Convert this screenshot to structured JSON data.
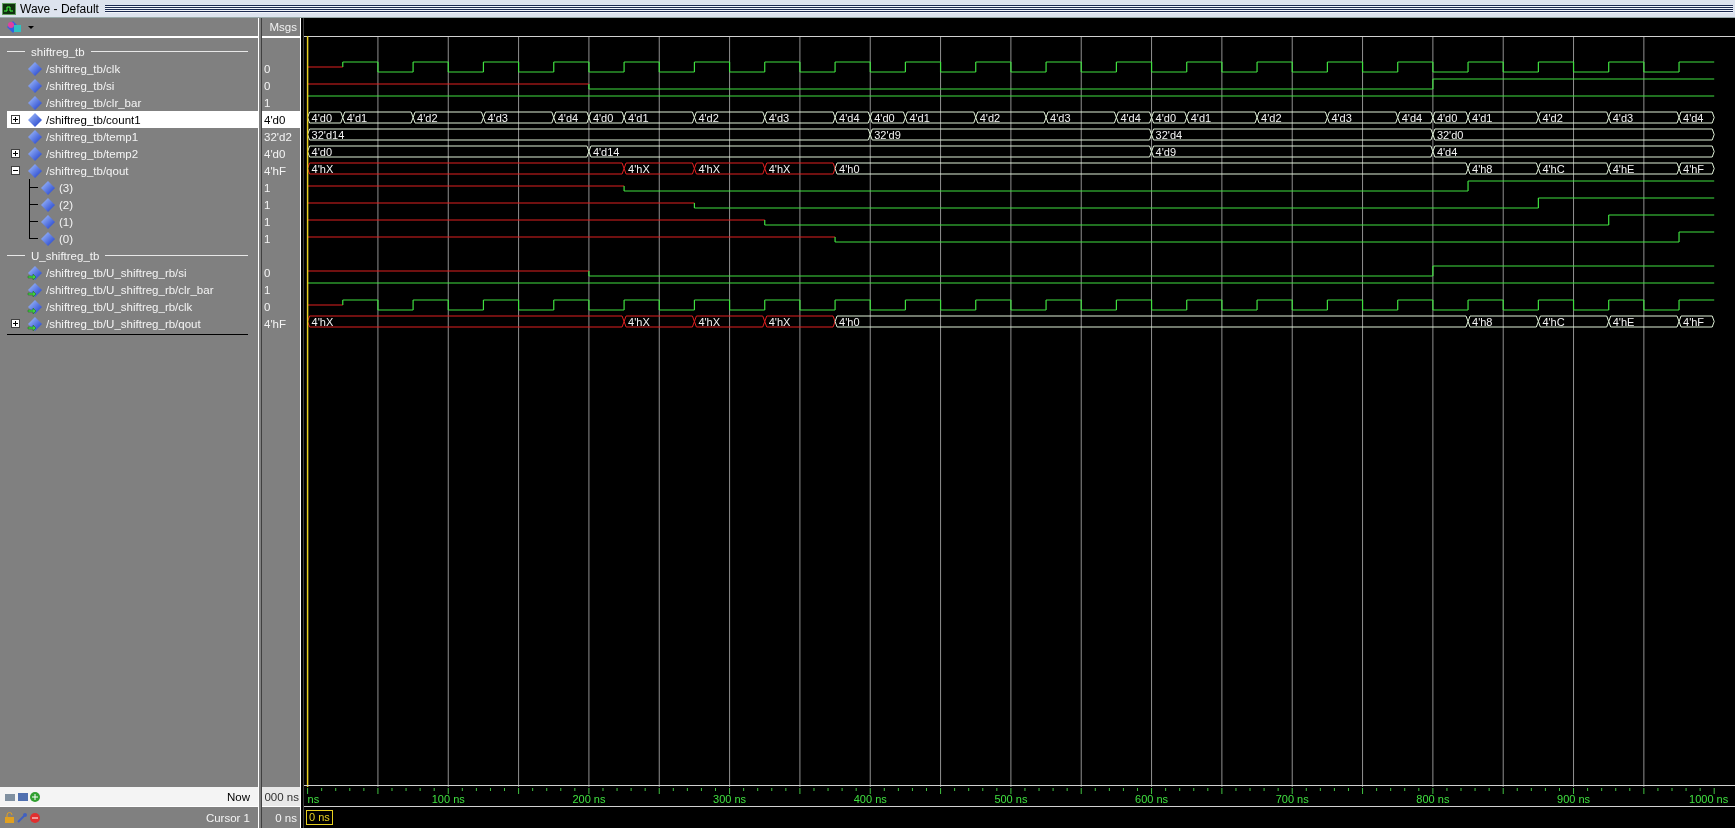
{
  "window": {
    "title": "Wave - Default"
  },
  "columns": {
    "values": "Msgs"
  },
  "signals": [
    {
      "kind": "group",
      "name": "shiftreg_tb",
      "children": [
        {
          "kind": "bit",
          "name": "/shiftreg_tb/clk",
          "value": "0",
          "port": false,
          "selected": false
        },
        {
          "kind": "bit",
          "name": "/shiftreg_tb/si",
          "value": "0",
          "port": false,
          "selected": false
        },
        {
          "kind": "bit",
          "name": "/shiftreg_tb/clr_bar",
          "value": "1",
          "port": false,
          "selected": false
        },
        {
          "kind": "bus",
          "name": "/shiftreg_tb/count1",
          "value": "4'd0",
          "port": false,
          "selected": true,
          "expanded": false,
          "segments": [
            {
              "label": "4'd0",
              "unknown": false
            },
            {
              "label": "4'd1",
              "unknown": false
            },
            {
              "label": "4'd2",
              "unknown": false
            },
            {
              "label": "4'd3",
              "unknown": false
            },
            {
              "label": "4'd4",
              "unknown": false
            },
            {
              "label": "4'd0",
              "unknown": false
            },
            {
              "label": "4'd1",
              "unknown": false
            },
            {
              "label": "4'd2",
              "unknown": false
            },
            {
              "label": "4'd3",
              "unknown": false
            },
            {
              "label": "4'd4",
              "unknown": false
            },
            {
              "label": "4'd0",
              "unknown": false
            },
            {
              "label": "4'd1",
              "unknown": false
            },
            {
              "label": "4'd2",
              "unknown": false
            },
            {
              "label": "4'd3",
              "unknown": false
            },
            {
              "label": "4'd4",
              "unknown": false
            },
            {
              "label": "4'd0",
              "unknown": false
            },
            {
              "label": "4'd1",
              "unknown": false
            },
            {
              "label": "4'd2",
              "unknown": false
            },
            {
              "label": "4'd3",
              "unknown": false
            },
            {
              "label": "4'd4",
              "unknown": false
            },
            {
              "label": "4'd0",
              "unknown": false
            },
            {
              "label": "4'd1",
              "unknown": false
            },
            {
              "label": "4'd2",
              "unknown": false
            },
            {
              "label": "4'd3",
              "unknown": false
            },
            {
              "label": "4'd4",
              "unknown": false
            }
          ]
        },
        {
          "kind": "bus",
          "name": "/shiftreg_tb/temp1",
          "value": "32'd2",
          "port": false,
          "selected": false,
          "segments": [
            {
              "label": "32'd14",
              "unknown": false
            },
            {
              "label": "32'd9",
              "unknown": false
            },
            {
              "label": "32'd4",
              "unknown": false
            },
            {
              "label": "32'd0",
              "unknown": false
            }
          ]
        },
        {
          "kind": "bus",
          "name": "/shiftreg_tb/temp2",
          "value": "4'd0",
          "port": false,
          "selected": false,
          "expanded": false,
          "segments": [
            {
              "label": "4'd0",
              "unknown": false
            },
            {
              "label": "4'd14",
              "unknown": false
            },
            {
              "label": "4'd9",
              "unknown": false
            },
            {
              "label": "4'd4",
              "unknown": false
            }
          ]
        },
        {
          "kind": "bus",
          "name": "/shiftreg_tb/qout",
          "value": "4'hF",
          "port": false,
          "selected": false,
          "expanded": true,
          "segments": [
            {
              "label": "4'hX",
              "unknown": true
            },
            {
              "label": "4'hX",
              "unknown": true
            },
            {
              "label": "4'hX",
              "unknown": true
            },
            {
              "label": "4'hX",
              "unknown": true
            },
            {
              "label": "4'h0",
              "unknown": false
            },
            {
              "label": "4'h8",
              "unknown": false
            },
            {
              "label": "4'hC",
              "unknown": false
            },
            {
              "label": "4'hE",
              "unknown": false
            },
            {
              "label": "4'hF",
              "unknown": false
            }
          ],
          "children": [
            {
              "kind": "bit",
              "name": "(3)",
              "value": "1",
              "port": false,
              "selected": false
            },
            {
              "kind": "bit",
              "name": "(2)",
              "value": "1",
              "port": false,
              "selected": false
            },
            {
              "kind": "bit",
              "name": "(1)",
              "value": "1",
              "port": false,
              "selected": false
            },
            {
              "kind": "bit",
              "name": "(0)",
              "value": "1",
              "port": false,
              "selected": false
            }
          ]
        }
      ]
    },
    {
      "kind": "group",
      "name": "U_shiftreg_tb",
      "children": [
        {
          "kind": "bit",
          "name": "/shiftreg_tb/U_shiftreg_rb/si",
          "value": "0",
          "port": true,
          "selected": false
        },
        {
          "kind": "bit",
          "name": "/shiftreg_tb/U_shiftreg_rb/clr_bar",
          "value": "1",
          "port": true,
          "selected": false
        },
        {
          "kind": "bit",
          "name": "/shiftreg_tb/U_shiftreg_rb/clk",
          "value": "0",
          "port": true,
          "selected": false
        },
        {
          "kind": "bus",
          "name": "/shiftreg_tb/U_shiftreg_rb/qout",
          "value": "4'hF",
          "port": true,
          "selected": false,
          "expanded": false,
          "segments": [
            {
              "label": "4'hX",
              "unknown": true
            },
            {
              "label": "4'hX",
              "unknown": true
            },
            {
              "label": "4'hX",
              "unknown": true
            },
            {
              "label": "4'hX",
              "unknown": true
            },
            {
              "label": "4'h0",
              "unknown": false
            },
            {
              "label": "4'h8",
              "unknown": false
            },
            {
              "label": "4'hC",
              "unknown": false
            },
            {
              "label": "4'hE",
              "unknown": false
            },
            {
              "label": "4'hF",
              "unknown": false
            }
          ]
        }
      ]
    }
  ],
  "now": {
    "label": "Now",
    "value": "000 ns"
  },
  "cursor": {
    "label": "Cursor 1",
    "value": "0 ns",
    "marker": "0 ns"
  },
  "timeline": {
    "labels": [
      "ns",
      "100 ns",
      "200 ns",
      "300 ns",
      "400 ns",
      "500 ns",
      "600 ns",
      "700 ns",
      "800 ns",
      "900 ns",
      "1000 ns"
    ]
  }
}
